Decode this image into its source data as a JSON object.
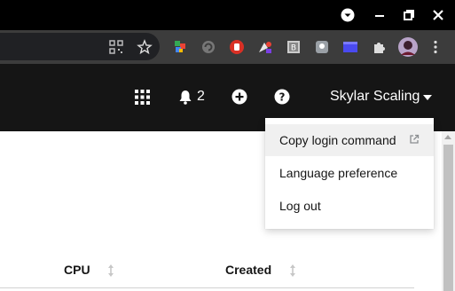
{
  "masthead": {
    "notification_count": "2",
    "username": "Skylar Scaling"
  },
  "user_menu": {
    "items": [
      {
        "label": "Copy login command"
      },
      {
        "label": "Language preference"
      },
      {
        "label": "Log out"
      }
    ]
  },
  "table": {
    "columns": [
      "CPU",
      "Created"
    ]
  },
  "icons": {
    "window": [
      "chevron-down-icon",
      "minimize-icon",
      "maximize-icon",
      "close-icon"
    ],
    "toolbar": [
      "qr-code-icon",
      "bookmark-star-icon",
      "extension-icons",
      "puzzle-extensions-icon",
      "profile-avatar",
      "kebab-menu-icon"
    ],
    "masthead": [
      "app-launcher-icon",
      "bell-icon",
      "plus-circle-icon",
      "help-icon",
      "caret-down-icon"
    ],
    "menu": [
      "external-link-icon"
    ]
  },
  "colors": {
    "masthead_bg": "#151515",
    "toolbar_bg": "#3c3c3c",
    "hover_bg": "#f0f0f0"
  }
}
